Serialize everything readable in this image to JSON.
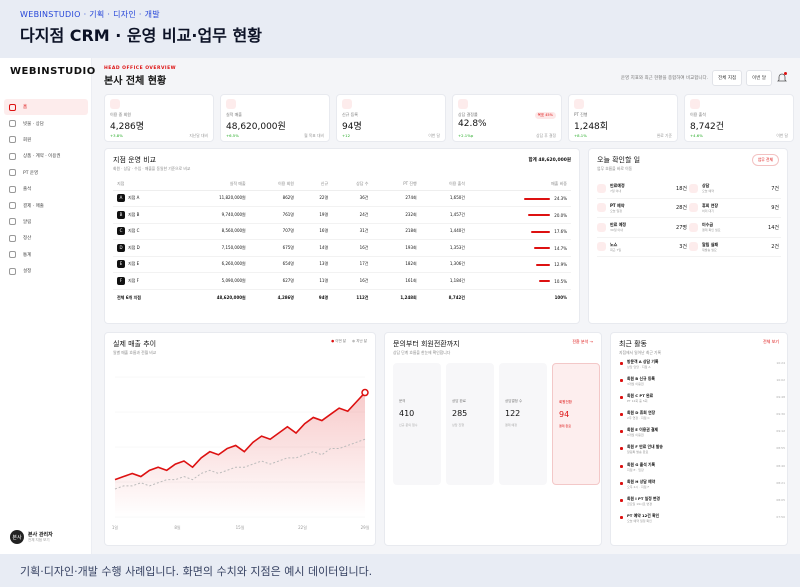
{
  "top_sub": "WEBINSTUDIO · 기획 · 디자인 · 개발",
  "top_title": "다지점 CRM · 운영 비교·업무 현황",
  "footer": "기획·디자인·개발 수행 사례입니다. 화면의 수치와 지점은 예시 데이터입니다.",
  "sidebar": {
    "logo": "WEBINSTUDIO",
    "items": [
      {
        "label": "홈"
      },
      {
        "label": "빗물 · 상담"
      },
      {
        "label": "회원"
      },
      {
        "label": "상품 · 계약 · 이용권"
      },
      {
        "label": "PT 운영"
      },
      {
        "label": "출석"
      },
      {
        "label": "결제 · 매출"
      },
      {
        "label": "알림"
      },
      {
        "label": "정산"
      },
      {
        "label": "통계"
      },
      {
        "label": "설정"
      }
    ],
    "user_name": "본사 관리자",
    "user_role": "전체 지점 보기",
    "avatar": "본사"
  },
  "header": {
    "eyebrow": "HEAD OFFICE OVERVIEW",
    "title": "본사 전체 현황",
    "hint": "운영 지표와 최근 현황을 종합하여 비교합니다.",
    "btn1": "전체 지점",
    "btn2": "이번 달"
  },
  "kpis": [
    {
      "label": "이용 중 회원",
      "value": "4,286명",
      "delta": "+3.8%",
      "note": "지난달 대비"
    },
    {
      "label": "실적 매출",
      "value": "48,620,000원",
      "delta": "+6.5%",
      "note": "월 목표 대비"
    },
    {
      "label": "신규 등록",
      "value": "94명",
      "delta": "+12",
      "note": "이번 달"
    },
    {
      "label": "상담 결정률",
      "value": "42.8%",
      "delta": "+2.1%p",
      "note": "상담 후 결정",
      "badge": "목표 45%"
    },
    {
      "label": "PT 진행",
      "value": "1,248회",
      "delta": "+8.1%",
      "note": "완료 기준"
    },
    {
      "label": "이용 출석",
      "value": "8,742건",
      "delta": "+4.6%",
      "note": "이번 달"
    }
  ],
  "compare": {
    "title": "지점 운영 비교",
    "subtitle": "회원 · 상담 · 수입 · 매출을 동일한 기준으로 비교",
    "total_label": "합계 48,620,000원",
    "headers": [
      "지점",
      "실적 매출",
      "이용 회원",
      "신규",
      "상담 수",
      "PT 진행",
      "이용 출석",
      "매출 비중"
    ],
    "rows": [
      {
        "badge": "A",
        "name": "지점 A",
        "sales": "11,820,000원",
        "members": "862명",
        "new": "22명",
        "consult": "36건",
        "pt": "274회",
        "att": "1,650건",
        "share": "24.3%",
        "pct": 24.3
      },
      {
        "badge": "B",
        "name": "지점 B",
        "sales": "9,740,000원",
        "members": "761명",
        "new": "19명",
        "consult": "24건",
        "pt": "232회",
        "att": "1,457건",
        "share": "20.0%",
        "pct": 20.0
      },
      {
        "badge": "C",
        "name": "지점 C",
        "sales": "8,560,000원",
        "members": "707명",
        "new": "16명",
        "consult": "31건",
        "pt": "218회",
        "att": "1,440건",
        "share": "17.6%",
        "pct": 17.6
      },
      {
        "badge": "D",
        "name": "지점 D",
        "sales": "7,150,000원",
        "members": "675명",
        "new": "14명",
        "consult": "16건",
        "pt": "193회",
        "att": "1,353건",
        "share": "14.7%",
        "pct": 14.7
      },
      {
        "badge": "E",
        "name": "지점 E",
        "sales": "6,260,000원",
        "members": "654명",
        "new": "13명",
        "consult": "17건",
        "pt": "182회",
        "att": "1,306건",
        "share": "12.9%",
        "pct": 12.9
      },
      {
        "badge": "F",
        "name": "지점 F",
        "sales": "5,090,000원",
        "members": "627명",
        "new": "11명",
        "consult": "16건",
        "pt": "161회",
        "att": "1,184건",
        "share": "10.5%",
        "pct": 10.5
      }
    ],
    "total": {
      "name": "전체 6개 지점",
      "sales": "48,620,000원",
      "members": "4,286명",
      "new": "94명",
      "consult": "112건",
      "pt": "1,248회",
      "att": "8,742건",
      "share": "100%"
    }
  },
  "todo": {
    "title": "오늘 확인할 일",
    "subtitle": "업무 흐름을 바로 이동",
    "pill": "업무 전체",
    "items": [
      {
        "label": "만료예정",
        "sub": "7일 이내",
        "value": "18건"
      },
      {
        "label": "상담",
        "sub": "오늘 예약",
        "value": "7건"
      },
      {
        "label": "PT 예약",
        "sub": "오늘 일정",
        "value": "28건"
      },
      {
        "label": "휴회 연장",
        "sub": "처리 대기",
        "value": "9건"
      },
      {
        "label": "만료 예정",
        "sub": "30일 이내",
        "value": "27명"
      },
      {
        "label": "미수금",
        "sub": "결제 확인 필요",
        "value": "14건"
      },
      {
        "label": "노쇼",
        "sub": "최근 7일",
        "value": "3건"
      },
      {
        "label": "알림 실패",
        "sub": "재발송 필요",
        "value": "2건"
      }
    ]
  },
  "trend": {
    "title": "실제 매출 추이",
    "subtitle": "일별 매출 흐름과 전월 비교",
    "legend_a": "이번 달",
    "legend_b": "지난 달",
    "ticks": [
      "1일",
      "8일",
      "15일",
      "22일",
      "29일"
    ]
  },
  "funnel": {
    "title": "문의부터 회원전환까지",
    "subtitle": "상담 단계 흐름을 한눈에 확인합니다",
    "link": "전환 분석 →",
    "steps": [
      {
        "label": "문의",
        "value": "410",
        "sub": "신규 문의 접수"
      },
      {
        "label": "상담 완료",
        "value": "285",
        "sub": "상담 진행"
      },
      {
        "label": "상담결정 수",
        "value": "122",
        "sub": "결제 예정"
      },
      {
        "label": "회원전환",
        "value": "94",
        "sub": "결제 완료"
      }
    ]
  },
  "activity": {
    "title": "최근 활동",
    "subtitle": "지점에서 일어난 최근 기록",
    "link": "전체 보기",
    "items": [
      {
        "t": "방문객 A 상담 기록",
        "s": "상담 담당 · 지점 A",
        "time": "10:24"
      },
      {
        "t": "회원 B 신규 등록",
        "s": "3개월 이용권",
        "time": "10:02"
      },
      {
        "t": "회원 C PT 완료",
        "s": "PT 12회 중 5회",
        "time": "09:48"
      },
      {
        "t": "회원 D 휴회 연장",
        "s": "2주 연장 · 지점 C",
        "time": "09:30"
      },
      {
        "t": "회원 E 이용권 결제",
        "s": "6개월 이용권",
        "time": "09:12"
      },
      {
        "t": "회원 F 만료 안내 발송",
        "s": "알림톡 발송 완료",
        "time": "08:55"
      },
      {
        "t": "회원 G 출석 기록",
        "s": "지점 E · 입장",
        "time": "08:40"
      },
      {
        "t": "회원 H 상담 예약",
        "s": "오후 2시 · 지점 F",
        "time": "08:21"
      },
      {
        "t": "회원 I PT 일정 변경",
        "s": "금요일 19시로 변경",
        "time": "08:05"
      },
      {
        "t": "PT 예약 12건 확인",
        "s": "오늘 예약 일정 확인",
        "time": "07:50"
      }
    ]
  },
  "chart_data": {
    "type": "line",
    "x": [
      1,
      2,
      3,
      4,
      5,
      6,
      7,
      8,
      9,
      10,
      11,
      12,
      13,
      14,
      15,
      16,
      17,
      18,
      19,
      20,
      21,
      22,
      23,
      24,
      25,
      26,
      27,
      28,
      29,
      30
    ],
    "series": [
      {
        "name": "이번 달",
        "values": [
          12,
          13,
          14,
          13,
          15,
          16,
          15,
          17,
          18,
          16,
          19,
          21,
          20,
          22,
          23,
          21,
          24,
          26,
          25,
          27,
          29,
          27,
          30,
          32,
          31,
          33,
          35,
          34,
          37,
          40
        ]
      },
      {
        "name": "지난 달",
        "values": [
          9,
          10,
          10,
          11,
          10,
          11,
          12,
          12,
          13,
          12,
          14,
          15,
          14,
          15,
          16,
          16,
          17,
          18,
          17,
          18,
          19,
          19,
          20,
          21,
          20,
          22,
          22,
          23,
          24,
          25
        ]
      }
    ],
    "ylim": [
      0,
      45
    ]
  }
}
